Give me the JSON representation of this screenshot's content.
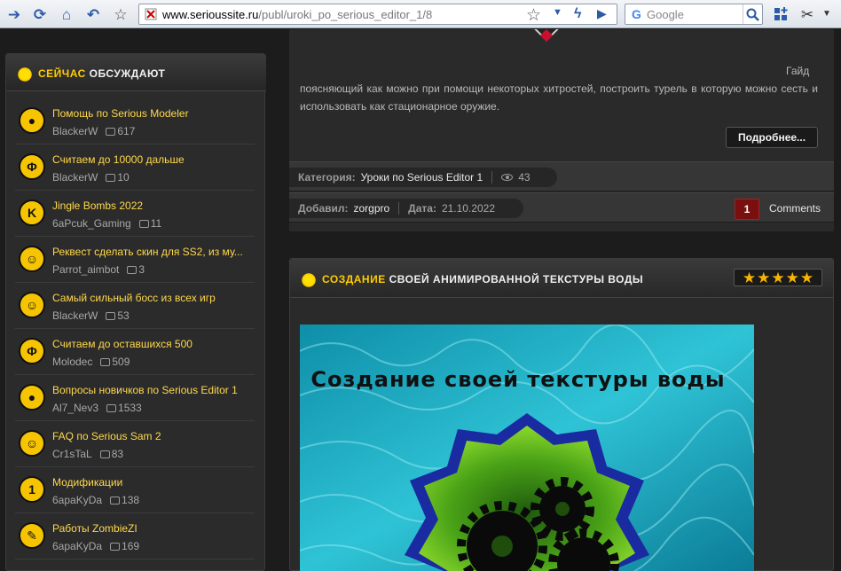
{
  "browser": {
    "url_domain": "www.serioussite.ru",
    "url_path": "/publ/uroki_po_serious_editor_1/8",
    "search_placeholder": "Google"
  },
  "colors": {
    "accent": "#ffcc00",
    "item_title": "#ffd84a",
    "badge": "#7a0f0f"
  },
  "sidebar": {
    "title_highlight": "СЕЙЧАС",
    "title_rest": "ОБСУЖДАЮТ",
    "items": [
      {
        "title": "Помощь по Serious Modeler",
        "author": "BlackerW",
        "comments": "617",
        "icon": "serious-sam-bomb-icon",
        "glyph": "●"
      },
      {
        "title": "Считаем до 10000 дальше",
        "author": "BlackerW",
        "comments": "10",
        "icon": "serious-sam-phi-icon",
        "glyph": "Φ"
      },
      {
        "title": "Jingle Bombs 2022",
        "author": "6aPcuk_Gaming",
        "comments": "11",
        "icon": "letter-k-icon",
        "glyph": "K"
      },
      {
        "title": "Реквест сделать скин для SS2, из му...",
        "author": "Parrot_aimbot",
        "comments": "3",
        "icon": "serious-sam-face-icon",
        "glyph": "☺"
      },
      {
        "title": "Самый сильный босс из всех игр",
        "author": "BlackerW",
        "comments": "53",
        "icon": "serious-sam-face-icon",
        "glyph": "☺"
      },
      {
        "title": "Считаем до оставшихся 500",
        "author": "Molodec",
        "comments": "509",
        "icon": "serious-sam-phi-icon",
        "glyph": "Φ"
      },
      {
        "title": "Вопросы новичков по Serious Editor 1",
        "author": "Al7_Nev3",
        "comments": "1533",
        "icon": "serious-sam-bomb-icon",
        "glyph": "●"
      },
      {
        "title": "FAQ по Serious Sam 2",
        "author": "Cr1sTaL",
        "comments": "83",
        "icon": "serious-sam-face-icon",
        "glyph": "☺"
      },
      {
        "title": "Модификации",
        "author": "6apaKyDa",
        "comments": "138",
        "icon": "number-one-icon",
        "glyph": "1"
      },
      {
        "title": "Работы ZombieZI",
        "author": "6apaKyDa",
        "comments": "169",
        "icon": "wrench-icon",
        "glyph": "✎"
      }
    ]
  },
  "article1": {
    "text_first": "Гайд",
    "text_rest": "поясняющий как можно при помощи некоторых хитростей, построить турель в которую можно сесть и использовать как стационарное оружие.",
    "more_label": "Подробнее...",
    "category_label": "Категория:",
    "category_value": "Уроки по Serious Editor 1",
    "views": "43",
    "added_label": "Добавил:",
    "added_value": "zorgpro",
    "date_label": "Дата:",
    "date_value": "21.10.2022",
    "comment_count": "1",
    "comments_label": "Comments"
  },
  "article2": {
    "title_highlight": "СОЗДАНИЕ",
    "title_rest": "СВОЕЙ АНИМИРОВАННОЙ ТЕКСТУРЫ ВОДЫ",
    "rating_stars": 5,
    "image_caption": "Создание своей текстуры воды"
  }
}
